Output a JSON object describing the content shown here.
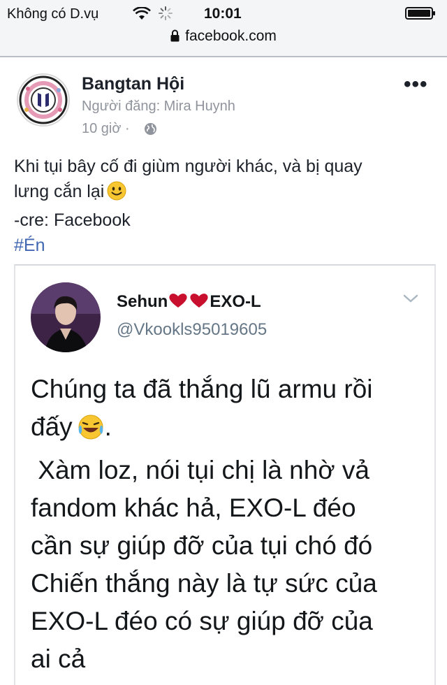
{
  "status_bar": {
    "carrier": "Không có D.vụ",
    "time": "10:01",
    "url": "facebook.com"
  },
  "icons": [
    "wifi-icon",
    "loading-spinner-icon",
    "battery-icon",
    "lock-icon",
    "globe-icon",
    "more-icon",
    "smile-emoji-icon",
    "laughing-emoji-icon",
    "heart-icon",
    "chevron-down-icon"
  ],
  "post": {
    "group_name": "Bangtan Hội",
    "posted_by": "Người đăng: Mira Huynh",
    "time": "10 giờ ·",
    "more_label": "•••",
    "text_line1": "Khi tụi bây cố đi giùm người khác, và bị quay",
    "text_line2": "lưng cắn lại",
    "text_line3": "-cre: Facebook",
    "hashtag": "#Én"
  },
  "tweet": {
    "name_part1": "Sehun",
    "name_part2": "EXO-L",
    "handle": "@Vkookls95019605",
    "line1": "Chúng ta đã thắng lũ armu rồi",
    "line2": "đấy",
    "line2_punct": ".",
    "line3": " Xàm loz, nói tụi chị là nhờ vả",
    "line4": "fandom khác hả, EXO-L đéo",
    "line5": "cần sự giúp đỡ của tụi chó đó",
    "line6": "Chiến thắng này là tự sức của",
    "line7": "EXO-L đéo có sự giúp đỡ của",
    "line8": "ai cả"
  },
  "colors": {
    "hashtag": "#4267b2",
    "secondary_text": "#90949c",
    "heart": "#c8102e",
    "emoji_yellow": "#f7c631"
  }
}
